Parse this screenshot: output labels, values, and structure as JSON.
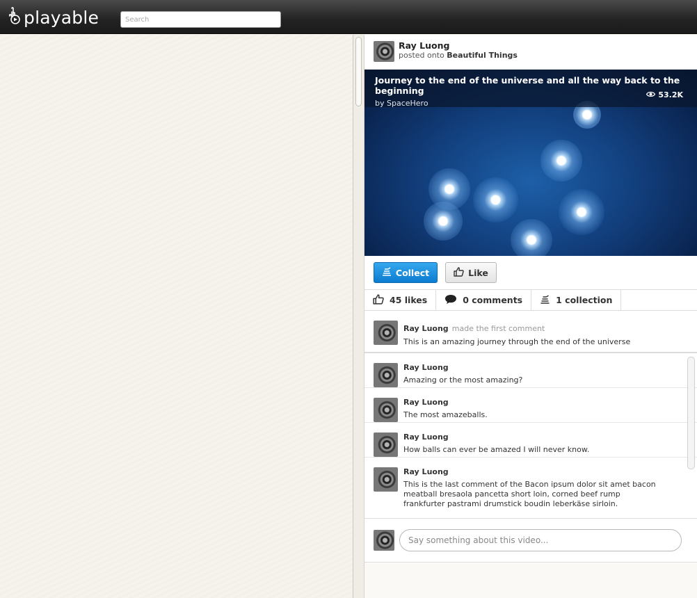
{
  "app": {
    "logo_text": "playable",
    "logo_icon": "hand-icon"
  },
  "search": {
    "placeholder": "Search"
  },
  "post": {
    "author": "Ray Luong",
    "posted_onto_prefix": "posted onto",
    "board": "Beautiful Things"
  },
  "video": {
    "title": "Journey to the end of the universe and all the way back to the beginning",
    "by": "by SpaceHero",
    "views": "53.2K",
    "views_icon": "eye-icon"
  },
  "actions": {
    "collect_label": "Collect",
    "like_label": "Like"
  },
  "stats": {
    "likes": "45 likes",
    "comments": "0 comments",
    "collections": "1 collection"
  },
  "first_comment": {
    "author": "Ray Luong",
    "note": "made the first comment",
    "text": "This is an amazing journey through the end of the universe"
  },
  "comments": [
    {
      "author": "Ray Luong",
      "text": "Amazing or the most amazing?"
    },
    {
      "author": "Ray Luong",
      "text": "The most amazeballs."
    },
    {
      "author": "Ray Luong",
      "text": "How balls can ever be amazed I will never know."
    },
    {
      "author": "Ray Luong",
      "text": "This is the last comment of the Bacon ipsum dolor sit amet bacon meatball bresaola pancetta short loin, corned beef rump frankfurter pastrami drumstick boudin leberkäse sirloin."
    }
  ],
  "composer": {
    "placeholder": "Say something about this video..."
  },
  "colors": {
    "accent": "#0b7ccf",
    "topbar": "#222222",
    "background": "#f5f3ec"
  }
}
